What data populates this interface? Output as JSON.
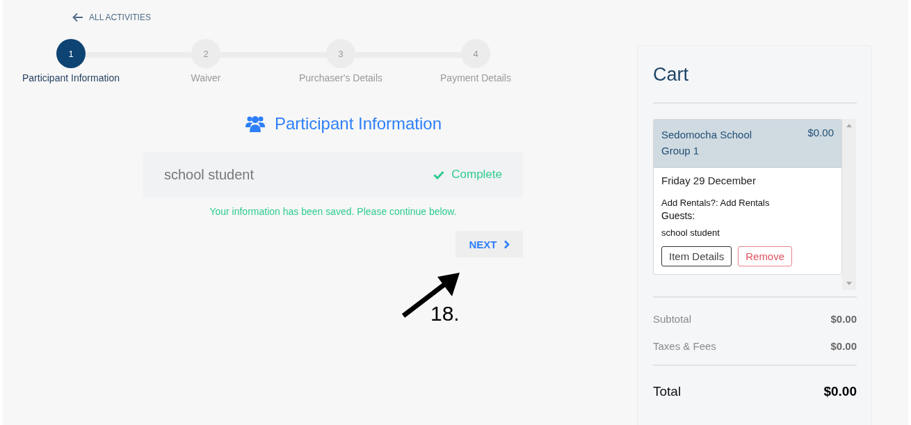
{
  "back_link": "ALL ACTIVITIES",
  "steps": [
    {
      "number": "1",
      "label": "Participant Information",
      "selected": true
    },
    {
      "number": "2",
      "label": "Waiver",
      "selected": false
    },
    {
      "number": "3",
      "label": "Purchaser's Details",
      "selected": false
    },
    {
      "number": "4",
      "label": "Payment Details",
      "selected": false
    }
  ],
  "section_title": "Participant Information",
  "participant": {
    "name": "school student",
    "status": "Complete",
    "complete": true
  },
  "message": "Your information has been saved. Please continue below.",
  "next_button": "NEXT",
  "annotation": "18.",
  "cart": {
    "title": "Cart",
    "items": [
      {
        "name": "Sedomocha School Group 1",
        "price": "$0.00",
        "date": "Friday 29 December",
        "rentals": "Add Rentals?: Add Rentals",
        "guests_label": "Guests:",
        "guests": "school student",
        "buttons": [
          "Item Details",
          "Remove"
        ]
      }
    ],
    "subtotal_label": "Subtotal",
    "subtotal": "$0.00",
    "taxes_label": "Taxes & Fees",
    "taxes": "$0.00",
    "total_label": "Total",
    "total": "$0.00"
  }
}
